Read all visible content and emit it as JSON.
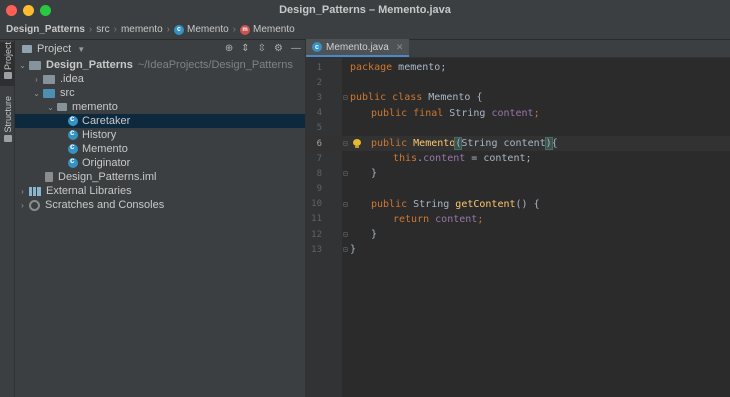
{
  "window": {
    "title": "Design_Patterns – Memento.java"
  },
  "breadcrumb": {
    "project": "Design_Patterns",
    "src": "src",
    "package": "memento",
    "class": "Memento",
    "member": "Memento"
  },
  "toolstrip": {
    "project_tab": "Project",
    "structure_tab": "Structure"
  },
  "project_panel": {
    "header": "Project",
    "tree": {
      "root_name": "Design_Patterns",
      "root_path": "~/IdeaProjects/Design_Patterns",
      "idea": ".idea",
      "src": "src",
      "memento_pkg": "memento",
      "classes": [
        "Caretaker",
        "History",
        "Memento",
        "Originator"
      ],
      "iml": "Design_Patterns.iml",
      "external_libraries": "External Libraries",
      "scratches": "Scratches and Consoles"
    }
  },
  "editor": {
    "tab_label": "Memento.java",
    "line_numbers": [
      "1",
      "2",
      "3",
      "4",
      "5",
      "6",
      "7",
      "8",
      "9",
      "10",
      "11",
      "12",
      "13"
    ],
    "current_line": 6,
    "code": {
      "l1_kw": "package",
      "l1_rest": " memento;",
      "l3_kw1": "public",
      "l3_kw2": "class",
      "l3_name": " Memento {",
      "l4_kw1": "public",
      "l4_kw2": "final",
      "l4_type": " String ",
      "l4_field": "content",
      "l4_end": ";",
      "l6_kw": "public",
      "l6_fn": "Memento",
      "l6_open": "(",
      "l6_params": "String content",
      "l6_close": ")",
      "l6_brace": "{",
      "l7_kw": "this",
      "l7_dot": ".",
      "l7_field": "content",
      "l7_rest": " = content;",
      "l8": "}",
      "l10_kw": "public",
      "l10_type": " String ",
      "l10_fn": "getContent",
      "l10_rest": "() {",
      "l11_kw": "return",
      "l11_field": "content",
      "l11_end": ";",
      "l12": "}",
      "l13": "}"
    }
  }
}
